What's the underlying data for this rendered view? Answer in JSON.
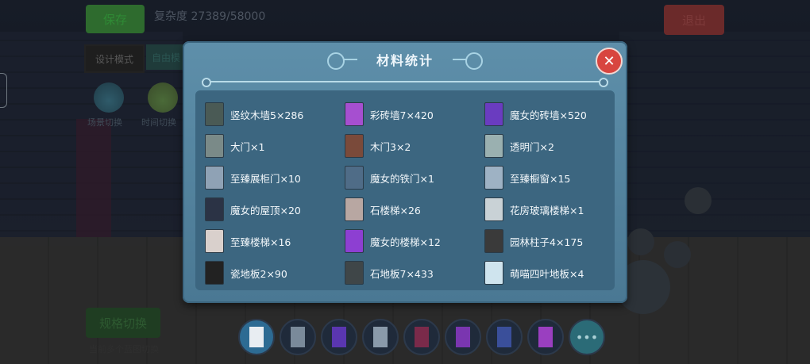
{
  "hud": {
    "save": "保存",
    "complexity": "复杂度 27389/58000",
    "exit": "退出",
    "design_mode": "设计模式",
    "free_mode": "自由模",
    "scene_switch": "场景切换",
    "time_switch": "时间切换",
    "spec_switch": "规格切换",
    "hint": "当前多个蓝图切换"
  },
  "modal": {
    "title": "材料统计",
    "close": "✕",
    "items": [
      {
        "label": "竖纹木墙5×286",
        "icon": "vertical-wood-wall-icon",
        "color": "#4a5a55"
      },
      {
        "label": "彩砖墙7×420",
        "icon": "colored-brick-wall-icon",
        "color": "#a64fd0"
      },
      {
        "label": "魔女的砖墙×520",
        "icon": "witch-brick-wall-icon",
        "color": "#6a3cc0"
      },
      {
        "label": "大门×1",
        "icon": "gate-icon",
        "color": "#7a8a88"
      },
      {
        "label": "木门3×2",
        "icon": "wooden-door-icon",
        "color": "#7a4a3a"
      },
      {
        "label": "透明门×2",
        "icon": "transparent-door-icon",
        "color": "#9ab0b0"
      },
      {
        "label": "至臻展柜门×10",
        "icon": "display-cabinet-door-icon",
        "color": "#8fa2b5"
      },
      {
        "label": "魔女的铁门×1",
        "icon": "witch-iron-gate-icon",
        "color": "#4f6c87"
      },
      {
        "label": "至臻橱窗×15",
        "icon": "showcase-window-icon",
        "color": "#9eb2c4"
      },
      {
        "label": "魔女的屋顶×20",
        "icon": "witch-roof-icon",
        "color": "#2b3345"
      },
      {
        "label": "石楼梯×26",
        "icon": "stone-stairs-icon",
        "color": "#b8a7a2"
      },
      {
        "label": "花房玻璃楼梯×1",
        "icon": "greenhouse-glass-stairs-icon",
        "color": "#c9d2d6"
      },
      {
        "label": "至臻楼梯×16",
        "icon": "premium-stairs-icon",
        "color": "#d9d0cc"
      },
      {
        "label": "魔女的楼梯×12",
        "icon": "witch-stairs-icon",
        "color": "#8d3fd2"
      },
      {
        "label": "园林柱子4×175",
        "icon": "garden-pillar-icon",
        "color": "#3a3a3a"
      },
      {
        "label": "瓷地板2×90",
        "icon": "porcelain-floor-icon",
        "color": "#222222"
      },
      {
        "label": "石地板7×433",
        "icon": "stone-floor-icon",
        "color": "#3f4648"
      },
      {
        "label": "萌喵四叶地板×4",
        "icon": "cat-clover-floor-icon",
        "color": "#cfe4ee"
      }
    ]
  },
  "toolbar": {
    "more": "•••",
    "tools": [
      {
        "icon": "eraser-icon",
        "color": "#e8edf2"
      },
      {
        "icon": "display-cabinet-icon",
        "color": "#7a8a9a"
      },
      {
        "icon": "witch-brick-wall-icon",
        "color": "#5a36b0"
      },
      {
        "icon": "display-cabinet-door-icon",
        "color": "#8a9aaa"
      },
      {
        "icon": "colored-brick-wall-icon",
        "color": "#7a2a4a"
      },
      {
        "icon": "witch-stairs-icon",
        "color": "#7a36b0"
      },
      {
        "icon": "gate-icon",
        "color": "#3a4f9a"
      },
      {
        "icon": "colored-brick-wall-icon",
        "color": "#9a3fc0"
      }
    ]
  }
}
